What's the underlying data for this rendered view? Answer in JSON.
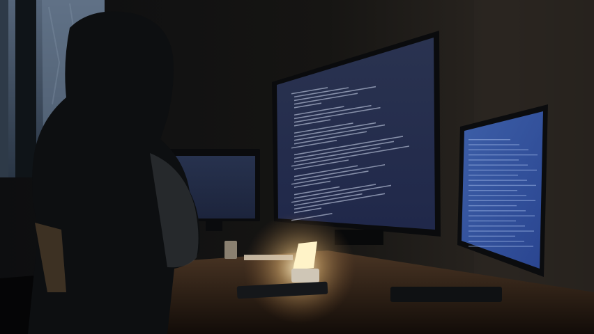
{
  "scene": {
    "colors": {
      "room": "#0b0c0e",
      "wall": "#1a1816",
      "window": "#3b4a5c",
      "monitor_glow": "#3a4a7a",
      "desk": "#3a2a1c",
      "lamp": "#fff3c8"
    },
    "icons": [
      "person-silhouette",
      "monitor",
      "lamp",
      "keyboard",
      "window"
    ]
  }
}
